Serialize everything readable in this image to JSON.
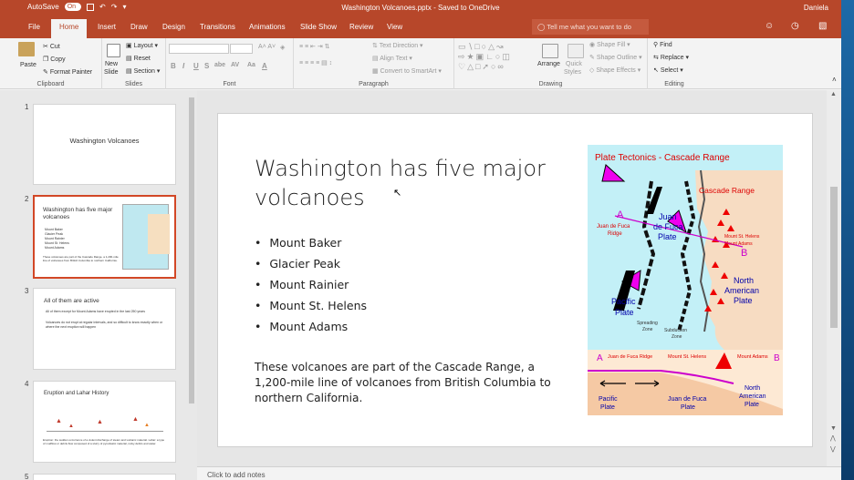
{
  "titlebar": {
    "autosave_label": "AutoSave",
    "autosave_state": "On",
    "document_title": "Washington Volcanoes.pptx - Saved to OneDrive",
    "user": "Daniela"
  },
  "tabs": [
    "File",
    "Home",
    "Insert",
    "Draw",
    "Design",
    "Transitions",
    "Animations",
    "Slide Show",
    "Review",
    "View"
  ],
  "tell_me": "Tell me what you want to do",
  "ribbon": {
    "clipboard": {
      "paste": "Paste",
      "cut": "Cut",
      "copy": "Copy",
      "format_painter": "Format Painter",
      "label": "Clipboard"
    },
    "slides": {
      "new_slide_1": "New",
      "new_slide_2": "Slide",
      "layout": "Layout",
      "reset": "Reset",
      "section": "Section",
      "label": "Slides"
    },
    "font": {
      "label": "Font",
      "bold": "B",
      "italic": "I",
      "underline": "U",
      "strike": "S",
      "shadow": "abe",
      "spacing": "AV",
      "case": "Aa",
      "color": "A"
    },
    "paragraph": {
      "text_direction": "Text Direction",
      "align_text": "Align Text",
      "convert_smartart": "Convert to SmartArt",
      "label": "Paragraph"
    },
    "drawing": {
      "arrange": "Arrange",
      "quick_styles_1": "Quick",
      "quick_styles_2": "Styles",
      "shape_fill": "Shape Fill",
      "shape_outline": "Shape Outline",
      "shape_effects": "Shape Effects",
      "label": "Drawing"
    },
    "editing": {
      "find": "Find",
      "replace": "Replace",
      "select": "Select",
      "label": "Editing"
    }
  },
  "thumbnails": [
    {
      "num": "1",
      "title": "Washington Volcanoes"
    },
    {
      "num": "2",
      "title": "Washington has five major volcanoes",
      "lines": [
        "Mount Baker",
        "Glacier Peak",
        "Mount Rainier",
        "Mount St. Helens",
        "Mount Adams"
      ],
      "foot": "These volcanoes are part of the Cascade Range, a 1,200-mile line of volcanoes from British Columbia to northern California."
    },
    {
      "num": "3",
      "title": "All of them are active",
      "lines": [
        "All of them except for Mount Adams have erupted in the last 250 years",
        "Volcanoes do not erupt at regular intervals, and so difficult to know exactly when or where the next eruption will happen"
      ]
    },
    {
      "num": "4",
      "title": "Eruption and Lahar History",
      "foot": "Eruption: the sudden occurrence of a violent discharge of steam and volcanic material. Lahar: a type of mudflow or debris flow composed of a slurry of pyroclastic material, rocky debris and water."
    },
    {
      "num": "5"
    }
  ],
  "slide": {
    "title": "Washington has five major volcanoes",
    "bullets": [
      "Mount Baker",
      "Glacier Peak",
      "Mount Rainier",
      "Mount St. Helens",
      "Mount Adams"
    ],
    "paragraph": "These volcanoes are part of the Cascade Range, a 1,200-mile line of volcanoes from British Columbia to northern California.",
    "map": {
      "title": "Plate Tectonics - Cascade Range",
      "cascade": "Cascade Range",
      "jdf_ridge_1": "Juan de Fuca",
      "jdf_ridge_2": "Ridge",
      "jdf_plate_1": "Juan",
      "jdf_plate_2": "de Fuca",
      "jdf_plate_3": "Plate",
      "st_helens": "Mount St. Helens",
      "adams": "Mount Adams",
      "na_1": "North",
      "na_2": "American",
      "na_3": "Plate",
      "pacific_1": "Pacific",
      "pacific_2": "Plate",
      "spreading_1": "Spreading",
      "spreading_2": "Zone",
      "subduction_1": "Subduction",
      "subduction_2": "Zone",
      "a": "A",
      "b": "B",
      "xs_ridge": "Juan de Fuca Ridge",
      "xs_helens": "Mount St. Helens",
      "xs_adams": "Mount Adams",
      "xs_pacific_1": "Pacific",
      "xs_pacific_2": "Plate",
      "xs_jdf": "Juan de Fuca",
      "xs_jdf_2": "Plate",
      "xs_na_1": "North",
      "xs_na_2": "American",
      "xs_na_3": "Plate"
    }
  },
  "notes_placeholder": "Click to add notes"
}
